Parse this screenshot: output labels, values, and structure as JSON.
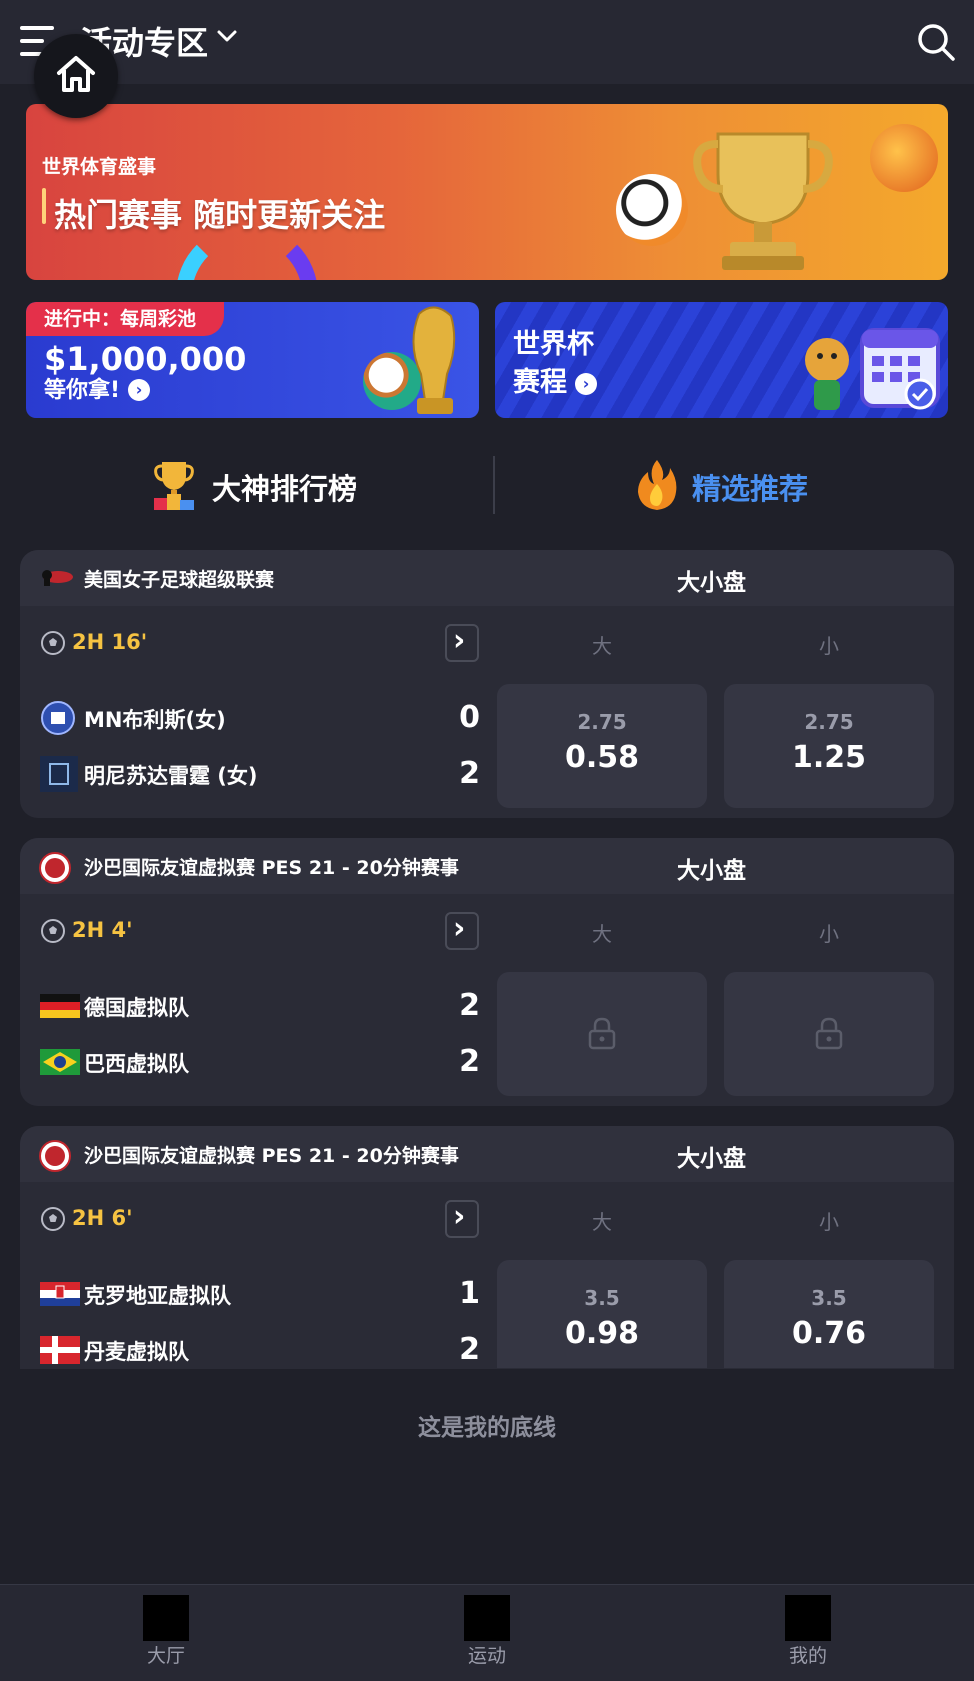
{
  "header": {
    "title": "活动专区"
  },
  "banner": {
    "subtitle": "世界体育盛事",
    "headline": "热门赛事 随时更新关注"
  },
  "promo_left": {
    "tag": "进行中：每周彩池",
    "amount": "$1,000,000",
    "sub": "等你拿!"
  },
  "promo_right": {
    "line1": "世界杯",
    "line2": "赛程"
  },
  "tabs": [
    {
      "label": "大神排行榜"
    },
    {
      "label": "精选推荐"
    }
  ],
  "colors": {
    "accent_blue": "#4a90f0",
    "time_yellow": "#f6c342",
    "tag_red": "#e4304a"
  },
  "matches": [
    {
      "league": "美国女子足球超级联赛",
      "market": "大小盘",
      "time": "2H 16'",
      "over_label": "大",
      "under_label": "小",
      "home": {
        "name": "MN布利斯(女)",
        "score": "0"
      },
      "away": {
        "name": "明尼苏达雷霆 (女)",
        "score": "2"
      },
      "over": {
        "line": "2.75",
        "price": "0.58"
      },
      "under": {
        "line": "2.75",
        "price": "1.25"
      }
    },
    {
      "league": "沙巴国际友谊虚拟赛 PES 21 - 20分钟赛事",
      "market": "大小盘",
      "time": "2H 4'",
      "over_label": "大",
      "under_label": "小",
      "home": {
        "name": "德国虚拟队",
        "score": "2"
      },
      "away": {
        "name": "巴西虚拟队",
        "score": "2"
      },
      "locked": true
    },
    {
      "league": "沙巴国际友谊虚拟赛 PES 21 - 20分钟赛事",
      "market": "大小盘",
      "time": "2H 6'",
      "over_label": "大",
      "under_label": "小",
      "home": {
        "name": "克罗地亚虚拟队",
        "score": "1"
      },
      "away": {
        "name": "丹麦虚拟队",
        "score": "2"
      },
      "over": {
        "line": "3.5",
        "price": "0.98"
      },
      "under": {
        "line": "3.5",
        "price": "0.76"
      }
    }
  ],
  "footer_text": "这是我的底线",
  "nav": [
    {
      "label": "大厅"
    },
    {
      "label": "运动"
    },
    {
      "label": "我的"
    }
  ]
}
